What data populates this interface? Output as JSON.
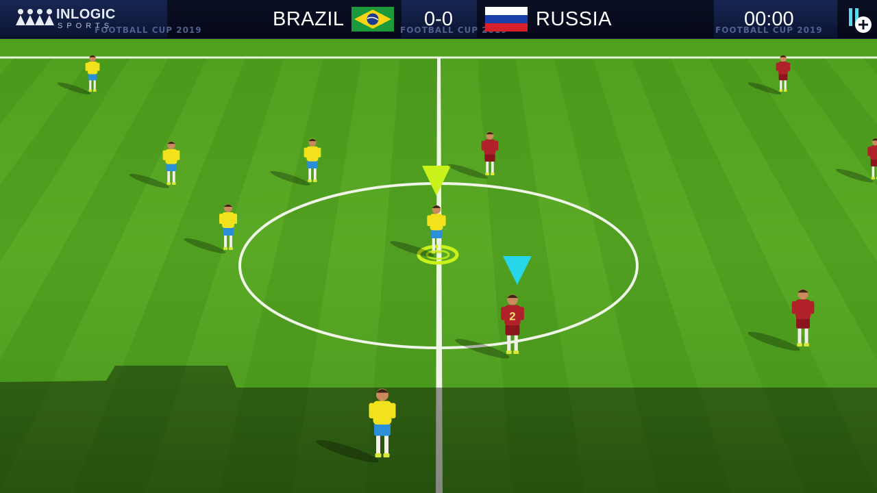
{
  "brand": {
    "name": "INLOGIC",
    "sub": "SPORTS"
  },
  "watermark": "FOOTBALL CUP 2019",
  "match": {
    "home_team": "BRAZIL",
    "away_team": "RUSSIA",
    "score": "0-0",
    "clock": "00:00"
  },
  "icons": {
    "home_flag": "brazil-flag-icon",
    "away_flag": "russia-flag-icon",
    "pause": "pause-plus-icon"
  },
  "players": {
    "away_jersey_number": "2"
  },
  "colors": {
    "hud_bg": "#05081a",
    "pitch_light": "#5fae2a",
    "pitch_dark": "#4c9a1f",
    "home_shirt": "#f2e21b",
    "home_shorts": "#2a8fd6",
    "away_shirt": "#b0212a",
    "selected_marker": "#c8f21a",
    "opponent_marker": "#27d6e8",
    "pause_icon": "#5ad8ec"
  }
}
